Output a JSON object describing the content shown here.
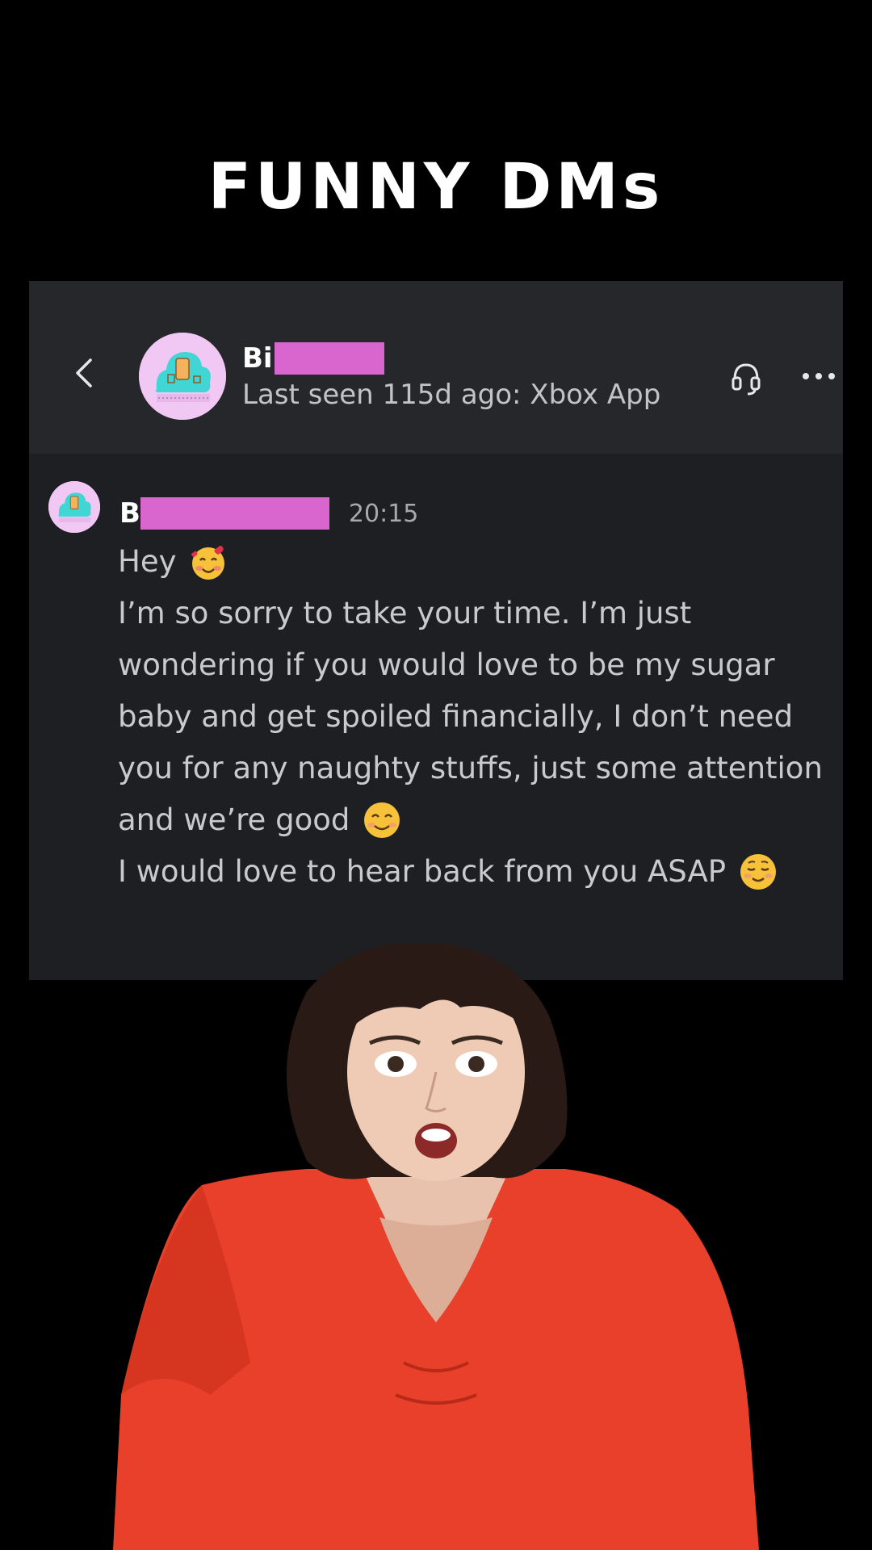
{
  "page": {
    "title": "FUNNY DMs"
  },
  "header": {
    "name_visible": "Bi",
    "status": "Last seen 115d ago: Xbox App",
    "back_icon": "chevron-left-icon",
    "call_icon": "headset-icon",
    "more_icon": "ellipsis-icon"
  },
  "message": {
    "sender_visible": "B",
    "time": "20:15",
    "lines": [
      "Hey",
      "I’m so sorry to take your time. I’m just",
      "wondering if you would love to be my sugar",
      "baby and get spoiled financially, I don’t need",
      "you for any naughty stuffs, just some attention",
      "and we’re good",
      "I would love to hear back from you ASAP"
    ],
    "emojis": {
      "line_0": "smiling-face-with-hearts",
      "line_5": "smiling-face-with-smiling-eyes",
      "line_6": "smiling-face-relaxed"
    }
  },
  "colors": {
    "background": "#000000",
    "card": "#1e1f23",
    "card_header": "#26272b",
    "redaction": "#d965cf",
    "avatar_bg": "#f1c8f3"
  }
}
